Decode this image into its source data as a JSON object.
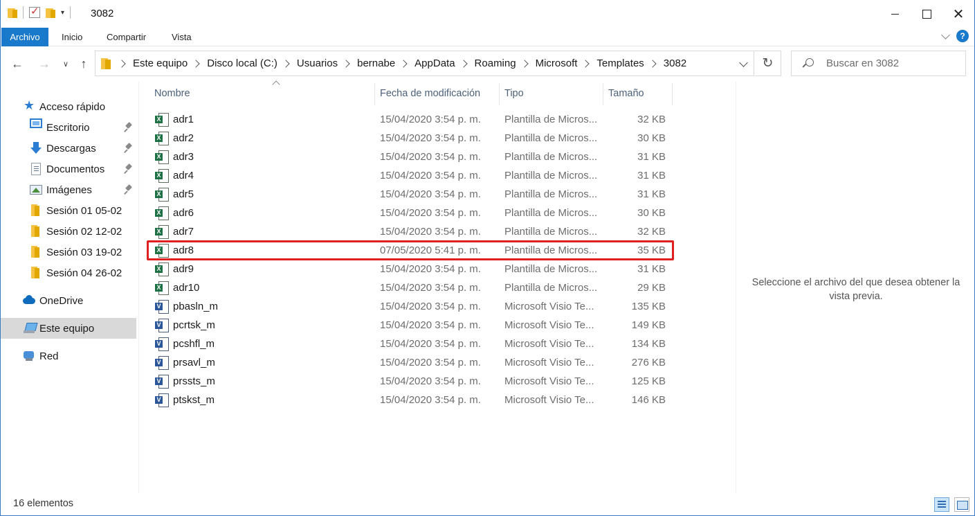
{
  "window": {
    "title": "3082",
    "controls": {
      "minimize": "",
      "maximize": "",
      "close": "✕"
    }
  },
  "ribbon": {
    "tabs": [
      "Archivo",
      "Inicio",
      "Compartir",
      "Vista"
    ],
    "help": "?"
  },
  "navigation": {
    "breadcrumb": [
      "Este equipo",
      "Disco local (C:)",
      "Usuarios",
      "bernabe",
      "AppData",
      "Roaming",
      "Microsoft",
      "Templates",
      "3082"
    ],
    "search_placeholder": "Buscar en 3082"
  },
  "sidebar": {
    "items": [
      {
        "label": "Acceso rápido",
        "icon": "star-icon",
        "pinned": false
      },
      {
        "label": "Escritorio",
        "icon": "desktop-icon",
        "pinned": true
      },
      {
        "label": "Descargas",
        "icon": "downloads-icon",
        "pinned": true
      },
      {
        "label": "Documentos",
        "icon": "documents-icon",
        "pinned": true
      },
      {
        "label": "Imágenes",
        "icon": "pictures-icon",
        "pinned": true
      },
      {
        "label": "Sesión 01 05-02",
        "icon": "folder-icon",
        "pinned": false
      },
      {
        "label": "Sesión 02 12-02",
        "icon": "folder-icon",
        "pinned": false
      },
      {
        "label": "Sesión 03 19-02",
        "icon": "folder-icon",
        "pinned": false
      },
      {
        "label": "Sesión 04 26-02",
        "icon": "folder-icon",
        "pinned": false
      },
      {
        "label": "OneDrive",
        "icon": "onedrive-icon",
        "pinned": false
      },
      {
        "label": "Este equipo",
        "icon": "this-pc-icon",
        "pinned": false,
        "selected": true
      },
      {
        "label": "Red",
        "icon": "network-icon",
        "pinned": false
      }
    ]
  },
  "file_list": {
    "columns": [
      "Nombre",
      "Fecha de modificación",
      "Tipo",
      "Tamaño"
    ],
    "rows": [
      {
        "name": "adr1",
        "date": "15/04/2020 3:54 p. m.",
        "type": "Plantilla de Micros...",
        "size": "32 KB",
        "icon": "excel-template-icon"
      },
      {
        "name": "adr2",
        "date": "15/04/2020 3:54 p. m.",
        "type": "Plantilla de Micros...",
        "size": "30 KB",
        "icon": "excel-template-icon"
      },
      {
        "name": "adr3",
        "date": "15/04/2020 3:54 p. m.",
        "type": "Plantilla de Micros...",
        "size": "31 KB",
        "icon": "excel-template-icon"
      },
      {
        "name": "adr4",
        "date": "15/04/2020 3:54 p. m.",
        "type": "Plantilla de Micros...",
        "size": "31 KB",
        "icon": "excel-template-icon"
      },
      {
        "name": "adr5",
        "date": "15/04/2020 3:54 p. m.",
        "type": "Plantilla de Micros...",
        "size": "31 KB",
        "icon": "excel-template-icon"
      },
      {
        "name": "adr6",
        "date": "15/04/2020 3:54 p. m.",
        "type": "Plantilla de Micros...",
        "size": "30 KB",
        "icon": "excel-template-icon"
      },
      {
        "name": "adr7",
        "date": "15/04/2020 3:54 p. m.",
        "type": "Plantilla de Micros...",
        "size": "32 KB",
        "icon": "excel-template-icon"
      },
      {
        "name": "adr8",
        "date": "07/05/2020 5:41 p. m.",
        "type": "Plantilla de Micros...",
        "size": "35 KB",
        "icon": "excel-template-icon",
        "highlighted": true
      },
      {
        "name": "adr9",
        "date": "15/04/2020 3:54 p. m.",
        "type": "Plantilla de Micros...",
        "size": "31 KB",
        "icon": "excel-template-icon"
      },
      {
        "name": "adr10",
        "date": "15/04/2020 3:54 p. m.",
        "type": "Plantilla de Micros...",
        "size": "29 KB",
        "icon": "excel-template-icon"
      },
      {
        "name": "pbasln_m",
        "date": "15/04/2020 3:54 p. m.",
        "type": "Microsoft Visio Te...",
        "size": "135 KB",
        "icon": "visio-template-icon"
      },
      {
        "name": "pcrtsk_m",
        "date": "15/04/2020 3:54 p. m.",
        "type": "Microsoft Visio Te...",
        "size": "149 KB",
        "icon": "visio-template-icon"
      },
      {
        "name": "pcshfl_m",
        "date": "15/04/2020 3:54 p. m.",
        "type": "Microsoft Visio Te...",
        "size": "134 KB",
        "icon": "visio-template-icon"
      },
      {
        "name": "prsavl_m",
        "date": "15/04/2020 3:54 p. m.",
        "type": "Microsoft Visio Te...",
        "size": "276 KB",
        "icon": "visio-template-icon"
      },
      {
        "name": "prssts_m",
        "date": "15/04/2020 3:54 p. m.",
        "type": "Microsoft Visio Te...",
        "size": "125 KB",
        "icon": "visio-template-icon"
      },
      {
        "name": "ptskst_m",
        "date": "15/04/2020 3:54 p. m.",
        "type": "Microsoft Visio Te...",
        "size": "146 KB",
        "icon": "visio-template-icon"
      }
    ]
  },
  "preview": {
    "message": "Seleccione el archivo del que desea obtener la vista previa."
  },
  "status": {
    "count": "16 elementos"
  },
  "colors": {
    "accent": "#1979ca",
    "highlight_border": "#e02020",
    "selection": "#d9d9d9"
  }
}
